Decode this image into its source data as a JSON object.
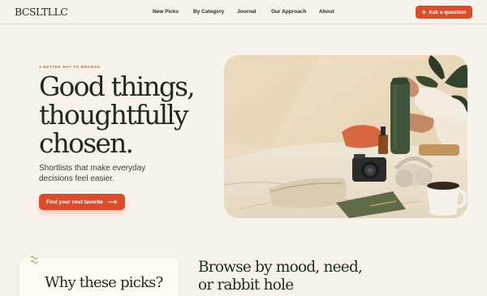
{
  "brand": {
    "logo": "BCSLTLLC"
  },
  "nav": {
    "items": [
      "New Picks",
      "By Category",
      "Journal",
      "Our Approach",
      "About"
    ]
  },
  "header": {
    "cta_label": "Ask a question",
    "cta_icon": "plus-icon"
  },
  "hero": {
    "eyebrow": "A BETTER WAY TO BROWSE",
    "headline_lines": [
      "Good things,",
      "thoughtfully",
      "chosen."
    ],
    "subtext": "Shortlists that make everyday decisions feel easier.",
    "cta_label": "Find your next favorite",
    "cta_icon": "arrow-right-icon",
    "image_icon": "lifestyle-photo"
  },
  "sections": {
    "why_title": "Why these picks?",
    "browse_title": "Browse by mood, need, or rabbit hole"
  },
  "colors": {
    "background": "#f8f3ea",
    "accent": "#d84d2c",
    "text": "#1f2a22"
  }
}
